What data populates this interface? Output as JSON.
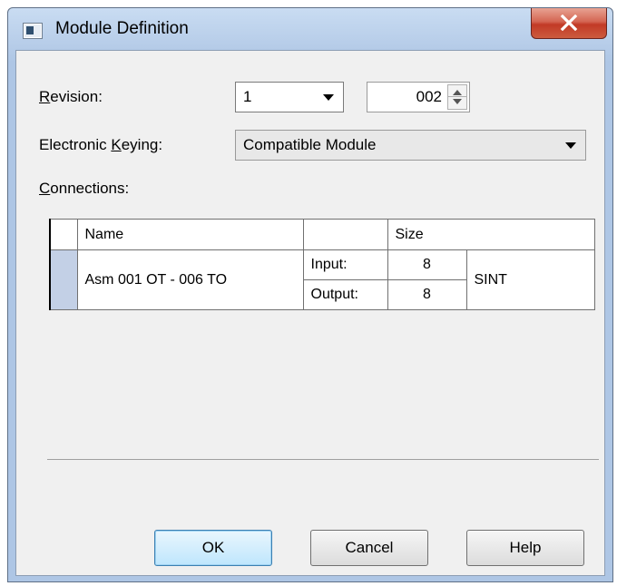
{
  "window": {
    "title": "Module Definition"
  },
  "revision": {
    "label_prefix": "",
    "label_accel": "R",
    "label_rest": "evision:",
    "major": "1",
    "minor": "002"
  },
  "keying": {
    "label_prefix": "Electronic ",
    "label_accel": "K",
    "label_rest": "eying:",
    "value": "Compatible Module"
  },
  "connections": {
    "label_accel": "C",
    "label_rest": "onnections:",
    "columns": {
      "name": "Name",
      "blank": "",
      "size": "Size"
    },
    "rows": [
      {
        "name": "Asm 001 OT - 006 TO",
        "input_label": "Input:",
        "input_size": "8",
        "output_label": "Output:",
        "output_size": "8",
        "type": "SINT"
      }
    ]
  },
  "buttons": {
    "ok": "OK",
    "cancel": "Cancel",
    "help": "Help"
  },
  "colors": {
    "title_gradient": "#c9dcf2",
    "close_red": "#c23a26",
    "grid_select": "#c3d0e6"
  }
}
